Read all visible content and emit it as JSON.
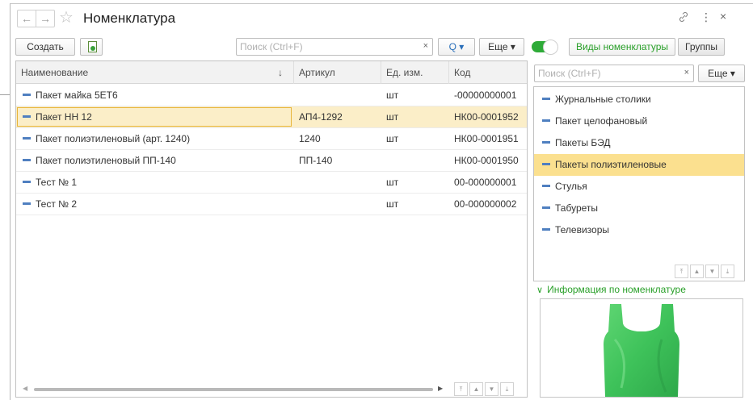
{
  "window": {
    "title": "Номенклатура",
    "back_icon": "←",
    "forward_icon": "→",
    "star_icon": "☆",
    "link_icon": "🔗",
    "more_icon": "⋮",
    "close_icon": "×"
  },
  "toolbar": {
    "create_label": "Создать",
    "search_placeholder": "Поиск (Ctrl+F)",
    "clear_icon": "×",
    "find_label": "Q ▾",
    "more_label": "Еще ▾",
    "toggle_on": true,
    "tab_kinds_label": "Виды номенклатуры",
    "tab_groups_label": "Группы"
  },
  "table": {
    "columns": [
      "Наименование",
      "Артикул",
      "Ед. изм.",
      "Код"
    ],
    "sort_icon": "↓",
    "rows": [
      {
        "name": "Пакет майка 5ЕТ6",
        "article": "",
        "unit": "шт",
        "code": "-00000000001"
      },
      {
        "name": "Пакет НН 12",
        "article": "АП4-1292",
        "unit": "шт",
        "code": "НК00-0001952",
        "selected": true
      },
      {
        "name": "Пакет полиэтиленовый (арт. 1240)",
        "article": "1240",
        "unit": "шт",
        "code": "НК00-0001951"
      },
      {
        "name": "Пакет полиэтиленовый ПП-140",
        "article": "ПП-140",
        "unit": "",
        "code": "НК00-0001950"
      },
      {
        "name": "Тест № 1",
        "article": "",
        "unit": "шт",
        "code": "00-000000001"
      },
      {
        "name": "Тест № 2",
        "article": "",
        "unit": "шт",
        "code": "00-000000002"
      }
    ]
  },
  "side": {
    "search_placeholder": "Поиск (Ctrl+F)",
    "clear_icon": "×",
    "more_label": "Еще ▾",
    "items": [
      {
        "label": "Журнальные столики"
      },
      {
        "label": "Пакет целофановый"
      },
      {
        "label": "Пакеты БЭД"
      },
      {
        "label": "Пакеты полиэтиленовые",
        "selected": true
      },
      {
        "label": "Стулья"
      },
      {
        "label": "Табуреты"
      },
      {
        "label": "Телевизоры"
      }
    ],
    "info_label": "Информация по номенклатуре",
    "info_chevron": "∨"
  },
  "colors": {
    "accent_green": "#2aa02a",
    "selection_row": "#fbeec8",
    "selection_item": "#fbe08f",
    "bag_green": "#3ec25a"
  }
}
